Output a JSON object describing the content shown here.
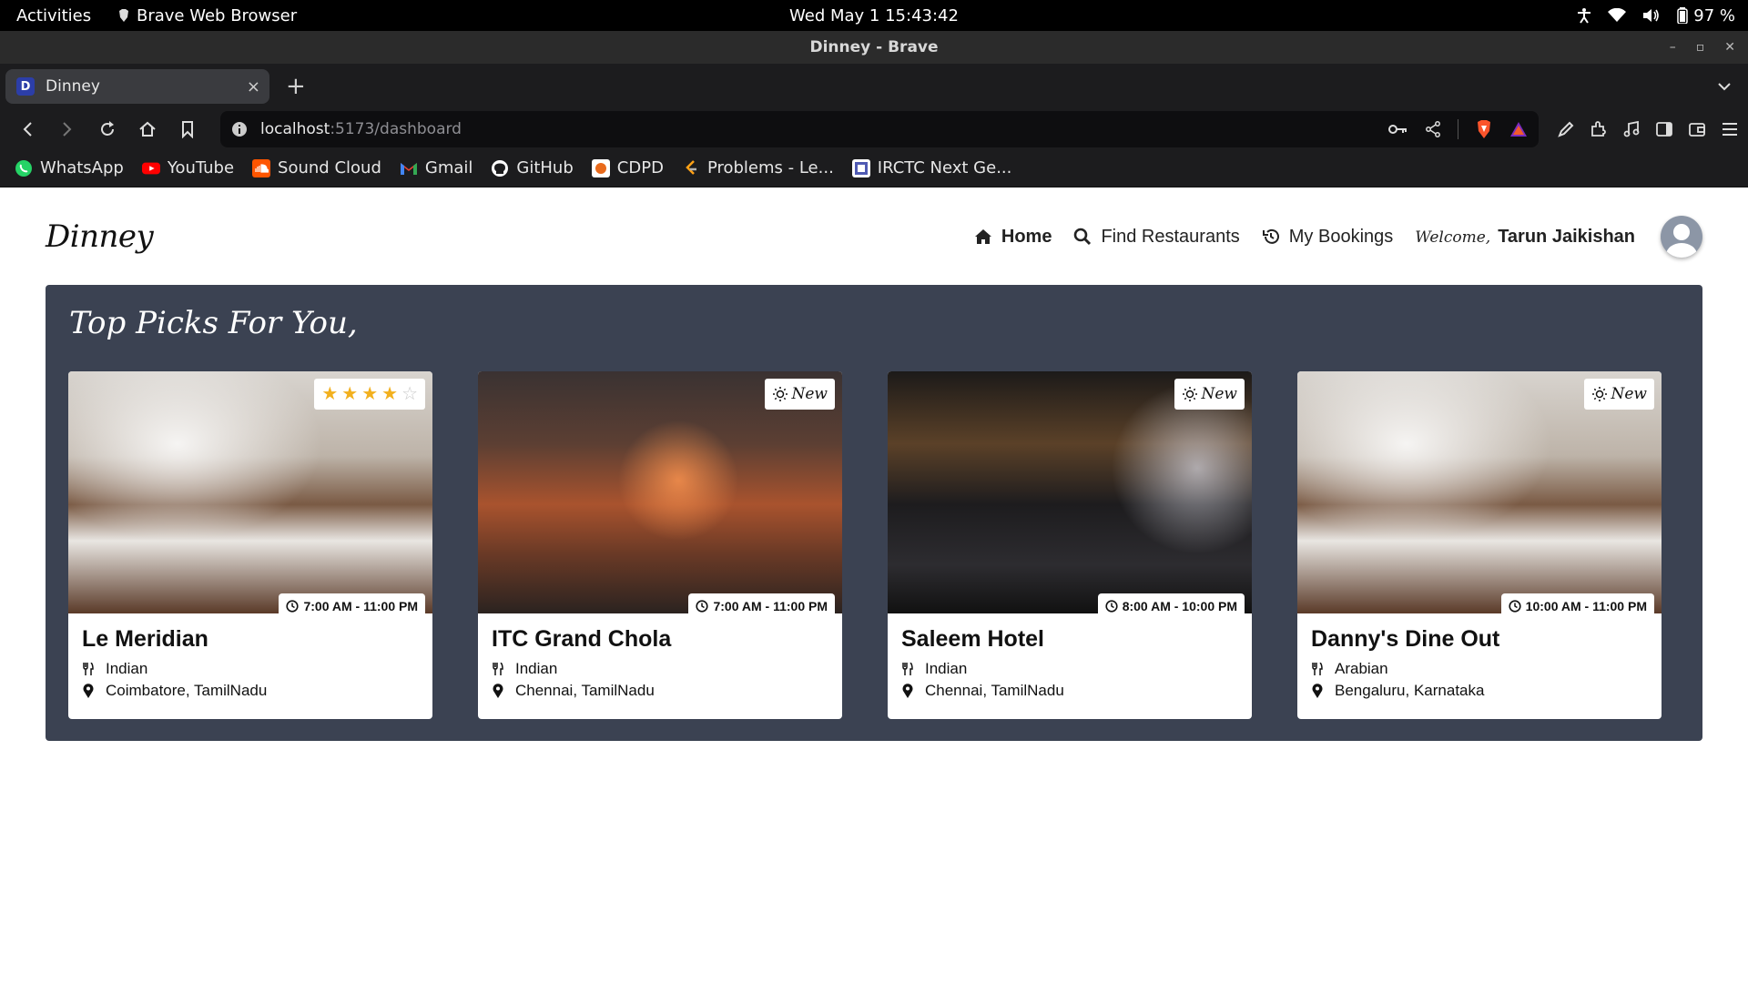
{
  "system_bar": {
    "activities": "Activities",
    "app_name": "Brave Web Browser",
    "clock": "Wed May 1  15:43:42",
    "battery": "97 %"
  },
  "window": {
    "title": "Dinney - Brave"
  },
  "tabs": [
    {
      "favicon": "D",
      "title": "Dinney",
      "close": "×"
    }
  ],
  "new_tab": "+",
  "address_bar": {
    "host": "localhost",
    "path": ":5173/dashboard"
  },
  "bookmarks": [
    {
      "label": "WhatsApp",
      "icon": "whatsapp-icon",
      "color": "#25d366"
    },
    {
      "label": "YouTube",
      "icon": "youtube-icon",
      "color": "#ff0000"
    },
    {
      "label": "Sound Cloud",
      "icon": "soundcloud-icon",
      "color": "#ff5500"
    },
    {
      "label": "Gmail",
      "icon": "gmail-icon",
      "color": "#ea4335"
    },
    {
      "label": "GitHub",
      "icon": "github-icon",
      "color": "#ffffff"
    },
    {
      "label": "CDPD",
      "icon": "cdpd-icon",
      "color": "#e86a1c"
    },
    {
      "label": "Problems - Le...",
      "icon": "leetcode-icon",
      "color": "#ffa116"
    },
    {
      "label": "IRCTC Next Ge...",
      "icon": "irctc-icon",
      "color": "#4f5ab3"
    }
  ],
  "site": {
    "logo": "Dinney",
    "nav": {
      "home": "Home",
      "find": "Find Restaurants",
      "bookings": "My Bookings",
      "welcome_label": "Welcome,",
      "user_name": "Tarun Jaikishan"
    },
    "section_title": "Top Picks For You,",
    "restaurants": [
      {
        "name": "Le Meridian",
        "cuisine": "Indian",
        "location": "Coimbatore, TamilNadu",
        "hours": "7:00 AM - 11:00 PM",
        "rating": 4,
        "rating_max": 5,
        "badge": ""
      },
      {
        "name": "ITC Grand Chola",
        "cuisine": "Indian",
        "location": "Chennai, TamilNadu",
        "hours": "7:00 AM - 11:00 PM",
        "badge": "New"
      },
      {
        "name": "Saleem Hotel",
        "cuisine": "Indian",
        "location": "Chennai, TamilNadu",
        "hours": "8:00 AM - 10:00 PM",
        "badge": "New"
      },
      {
        "name": "Danny's Dine Out",
        "cuisine": "Arabian",
        "location": "Bengaluru, Karnataka",
        "hours": "10:00 AM - 11:00 PM",
        "badge": "New"
      }
    ]
  },
  "colors": {
    "panel_bg": "#3b4252",
    "star": "#f2b01e",
    "browser_bg": "#1c1c1e"
  }
}
